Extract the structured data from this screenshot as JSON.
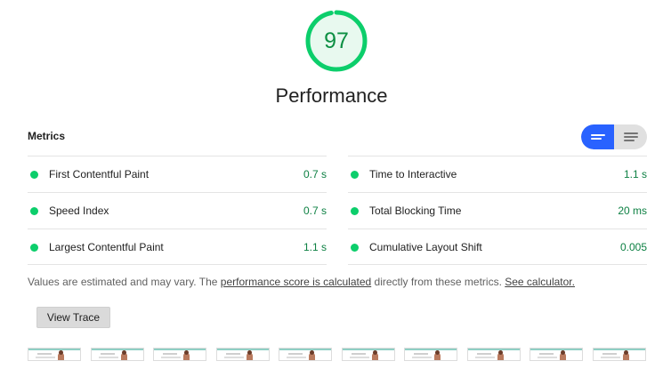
{
  "gauge": {
    "score": "97",
    "title": "Performance",
    "fraction": 0.97,
    "color": "#0cce6b",
    "track_color": "#e6f9ef"
  },
  "metrics": {
    "header": "Metrics",
    "left": [
      {
        "label": "First Contentful Paint",
        "value": "0.7 s",
        "status": "good"
      },
      {
        "label": "Speed Index",
        "value": "0.7 s",
        "status": "good"
      },
      {
        "label": "Largest Contentful Paint",
        "value": "1.1 s",
        "status": "good"
      }
    ],
    "right": [
      {
        "label": "Time to Interactive",
        "value": "1.1 s",
        "status": "good"
      },
      {
        "label": "Total Blocking Time",
        "value": "20 ms",
        "status": "good"
      },
      {
        "label": "Cumulative Layout Shift",
        "value": "0.005",
        "status": "good"
      }
    ]
  },
  "toggle": {
    "selected": "compact",
    "options": [
      "compact-view-icon",
      "expanded-view-icon"
    ]
  },
  "note": {
    "prefix": "Values are estimated and may vary. The ",
    "link1": "performance score is calculated",
    "middle": " directly from these metrics. ",
    "link2": "See calculator."
  },
  "buttons": {
    "view_trace": "View Trace"
  },
  "filmstrip": {
    "frame_count": 10
  }
}
